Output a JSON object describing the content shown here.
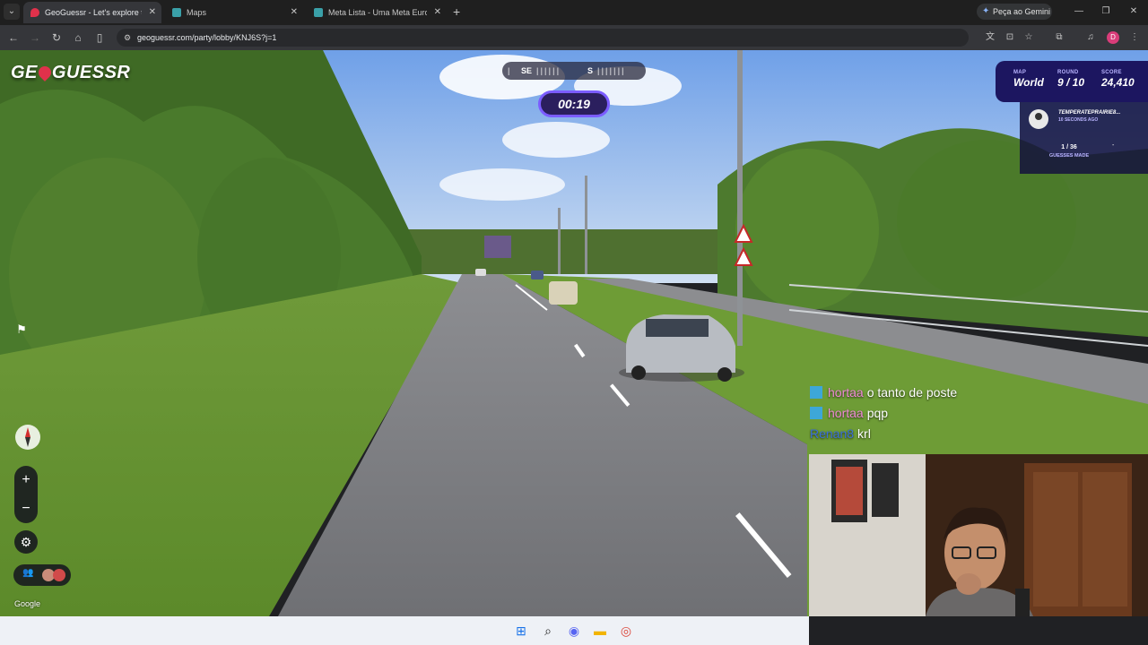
{
  "browser": {
    "tabs": [
      {
        "title": "GeoGuessr - Let's explore the world!",
        "active": true
      },
      {
        "title": "Maps",
        "active": false
      },
      {
        "title": "Meta Lista - Uma Meta Europa",
        "active": false
      }
    ],
    "gemini_label": "Peça ao Gemini",
    "url": "geoguessr.com/party/lobby/KNJ6S?j=1",
    "profile_initial": "D"
  },
  "game": {
    "logo_left": "GE",
    "logo_right": "GUESSR",
    "compass": {
      "left": "SE",
      "center": "S"
    },
    "timer": "00:19",
    "stats": {
      "map_label": "MAP",
      "map_value": "World",
      "round_label": "ROUND",
      "round_value": "9 / 10",
      "score_label": "SCORE",
      "score_value": "24,410"
    },
    "player": {
      "name": "TEMPERATEPRAIRIE8...",
      "time": "10 SECONDS AGO",
      "guesses": "1 / 36",
      "guesses_label": "GUESSES MADE",
      "dash": "-"
    },
    "zoom_in": "+",
    "zoom_out": "−",
    "attribution": "Google"
  },
  "chat": [
    {
      "nick": "hortaa",
      "message": "o tanto de poste",
      "nick_color": "pink",
      "badge": true
    },
    {
      "nick": "hortaa",
      "message": "pqp",
      "nick_color": "pink",
      "badge": true
    },
    {
      "nick": "Renan8",
      "message": "krl",
      "nick_color": "blue",
      "badge": false
    }
  ],
  "icons": {
    "tab_search": "chevron-down-icon",
    "back": "back-arrow-icon",
    "forward": "forward-arrow-icon",
    "reload": "reload-icon",
    "home": "home-icon",
    "split": "side-panel-icon",
    "site_info": "site-info-icon",
    "translate": "translate-icon",
    "install": "install-icon",
    "bookmark": "star-icon",
    "extensions": "puzzle-icon",
    "media": "media-controls-icon",
    "menu": "kebab-menu-icon"
  },
  "colors": {
    "hud_purple": "#1c1660",
    "timer_border": "#7b5cff",
    "logo_pin": "#e0314b"
  }
}
